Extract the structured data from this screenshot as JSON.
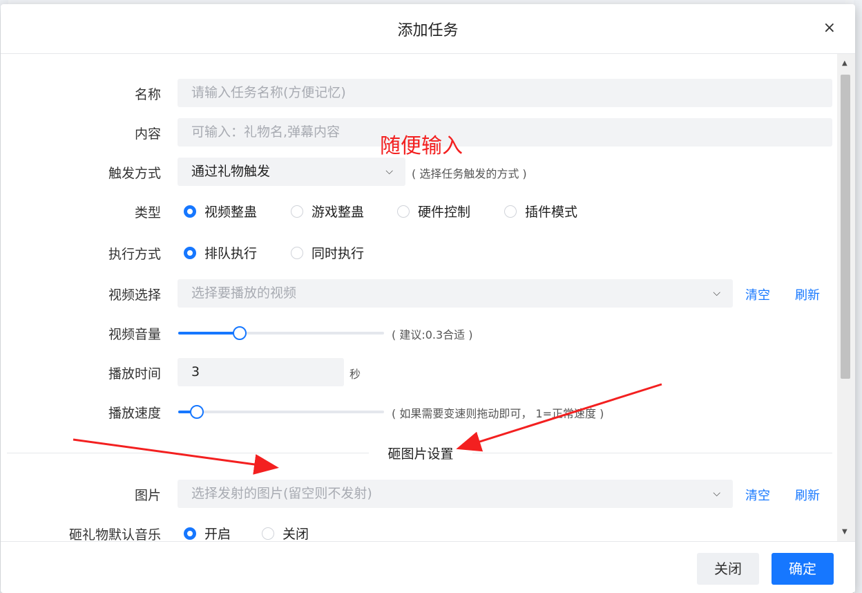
{
  "modal": {
    "title": "添加任务",
    "close_icon": "×"
  },
  "annotation": "随便输入",
  "fields": {
    "name": {
      "label": "名称",
      "placeholder": "请输入任务名称(方便记忆)"
    },
    "content": {
      "label": "内容",
      "placeholder": "可输入：礼物名,弹幕内容"
    },
    "trigger": {
      "label": "触发方式",
      "value": "通过礼物触发",
      "hint": "( 选择任务触发的方式 )"
    },
    "type": {
      "label": "类型",
      "options": [
        "视频整蛊",
        "游戏整蛊",
        "硬件控制",
        "插件模式"
      ],
      "selected": 0
    },
    "exec": {
      "label": "执行方式",
      "options": [
        "排队执行",
        "同时执行"
      ],
      "selected": 0
    },
    "video": {
      "label": "视频选择",
      "placeholder": "选择要播放的视频",
      "clear": "清空",
      "refresh": "刷新"
    },
    "volume": {
      "label": "视频音量",
      "hint": "( 建议:0.3合适 )",
      "level": 0.3
    },
    "duration": {
      "label": "播放时间",
      "value": "3",
      "unit": "秒"
    },
    "speed": {
      "label": "播放速度",
      "hint": "( 如果需要变速则拖动即可， 1=正常速度 )",
      "level": 0.09
    },
    "section": "砸图片设置",
    "image": {
      "label": "图片",
      "placeholder": "选择发射的图片(留空则不发射)",
      "clear": "清空",
      "refresh": "刷新"
    },
    "music": {
      "label": "砸礼物默认音乐",
      "options": [
        "开启",
        "关闭"
      ],
      "selected": 0
    }
  },
  "footer": {
    "cancel": "关闭",
    "ok": "确定"
  },
  "colors": {
    "accent": "#1677ff",
    "annotation": "#f32020"
  }
}
